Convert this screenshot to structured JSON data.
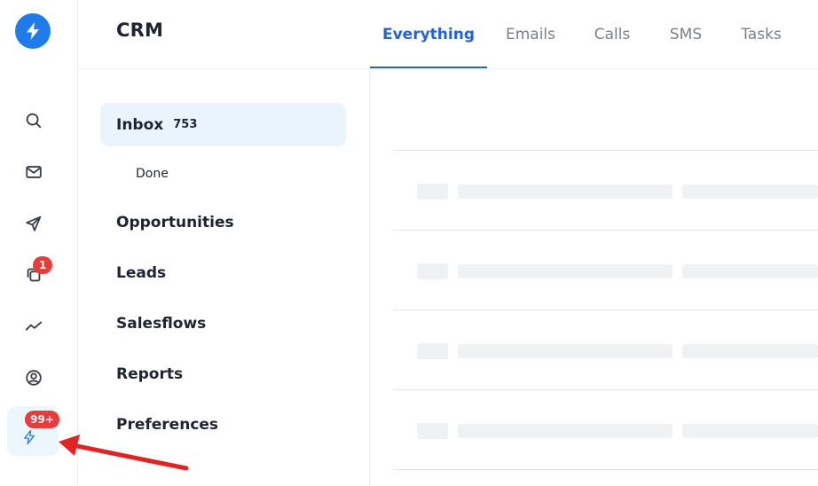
{
  "app": {
    "title": "CRM",
    "logo_icon": "bolt-icon",
    "brand_color": "#1f7bea"
  },
  "rail": {
    "items": [
      {
        "name": "search",
        "icon": "search-icon"
      },
      {
        "name": "mail",
        "icon": "mail-icon"
      },
      {
        "name": "send",
        "icon": "send-icon"
      },
      {
        "name": "copies",
        "icon": "copy-icon",
        "badge": "1"
      },
      {
        "name": "trends",
        "icon": "trend-icon"
      },
      {
        "name": "account",
        "icon": "user-circle-icon"
      },
      {
        "name": "notifications",
        "icon": "bolt-icon",
        "badge": "99+",
        "active": true
      }
    ],
    "badge_color": "#ea3b3b"
  },
  "tabs": [
    {
      "label": "Everything",
      "active": true
    },
    {
      "label": "Emails"
    },
    {
      "label": "Calls"
    },
    {
      "label": "SMS"
    },
    {
      "label": "Tasks"
    }
  ],
  "nav": {
    "inbox": {
      "label": "Inbox",
      "count": "753"
    },
    "done": "Done",
    "opportunities": "Opportunities",
    "leads": "Leads",
    "salesflows": "Salesflows",
    "reports": "Reports",
    "preferences": "Preferences"
  },
  "accent_color": "#2362d9",
  "annotation": {
    "arrow_color": "#e02424"
  }
}
